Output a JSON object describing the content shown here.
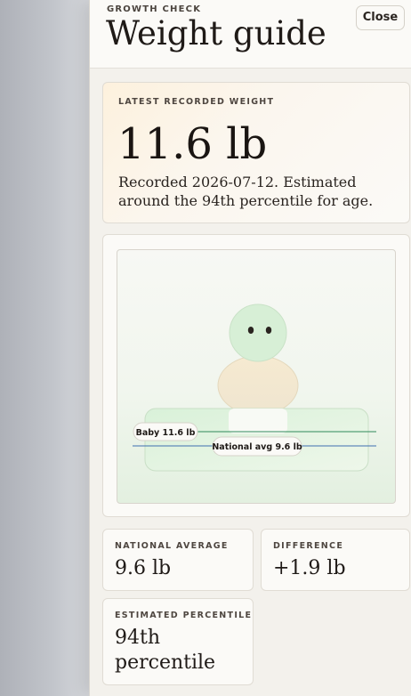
{
  "header": {
    "eyebrow": "GROWTH CHECK",
    "title": "Weight guide",
    "close_label": "Close"
  },
  "latest": {
    "label": "LATEST RECORDED WEIGHT",
    "value": "11.6 lb",
    "description": "Recorded 2026-07-12. Estimated around the 94th percentile for age."
  },
  "illustration": {
    "baby_marker_label": "Baby 11.6 lb",
    "national_marker_label": "National avg 9.6 lb",
    "colors": {
      "baby_line": "#2f8a5a",
      "national_line": "#3f6fb0"
    }
  },
  "stats": {
    "national": {
      "label": "NATIONAL AVERAGE",
      "value": "9.6 lb"
    },
    "difference": {
      "label": "DIFFERENCE",
      "value": "+1.9 lb"
    },
    "percentile": {
      "label": "ESTIMATED PERCENTILE",
      "value": "94th percentile"
    }
  }
}
